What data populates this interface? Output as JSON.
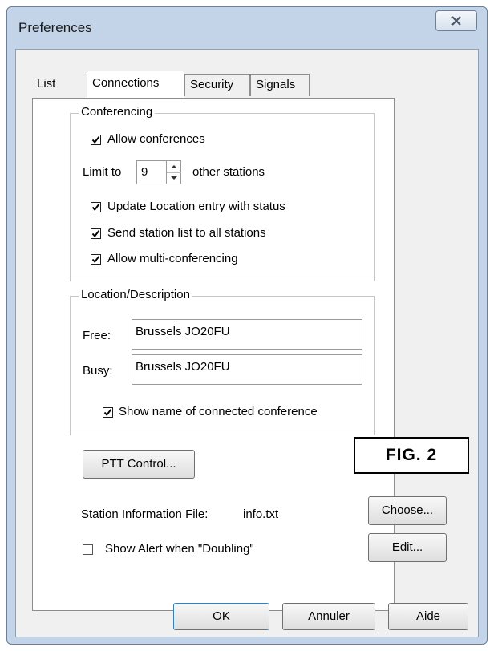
{
  "window": {
    "title": "Preferences",
    "close_icon": "close-icon"
  },
  "tabs": [
    {
      "label": "List",
      "active": false
    },
    {
      "label": "Connections",
      "active": true
    },
    {
      "label": "Security",
      "active": false
    },
    {
      "label": "Signals",
      "active": false
    }
  ],
  "conferencing": {
    "legend": "Conferencing",
    "allow_conferences": {
      "label": "Allow conferences",
      "checked": true
    },
    "limit_to_label": "Limit to",
    "limit_value": "9",
    "other_stations_label": "other stations",
    "update_location": {
      "label": "Update Location entry with status",
      "checked": true
    },
    "send_station_list": {
      "label": "Send station list to all stations",
      "checked": true
    },
    "allow_multi": {
      "label": "Allow multi-conferencing",
      "checked": true
    }
  },
  "location": {
    "legend": "Location/Description",
    "free_label": "Free:",
    "free_value": "Brussels JO20FU",
    "busy_label": "Busy:",
    "busy_value": "Brussels JO20FU",
    "show_name": {
      "label": "Show name of connected conference",
      "checked": true
    }
  },
  "ptt_button": "PTT Control...",
  "fig_label": "FIG.  2",
  "station_info": {
    "label": "Station Information File:",
    "value": "info.txt",
    "choose_button": "Choose..."
  },
  "doubling": {
    "label": "Show Alert when \"Doubling\"",
    "checked": false
  },
  "edit_button": "Edit...",
  "footer": {
    "ok": "OK",
    "cancel": "Annuler",
    "help": "Aide"
  }
}
